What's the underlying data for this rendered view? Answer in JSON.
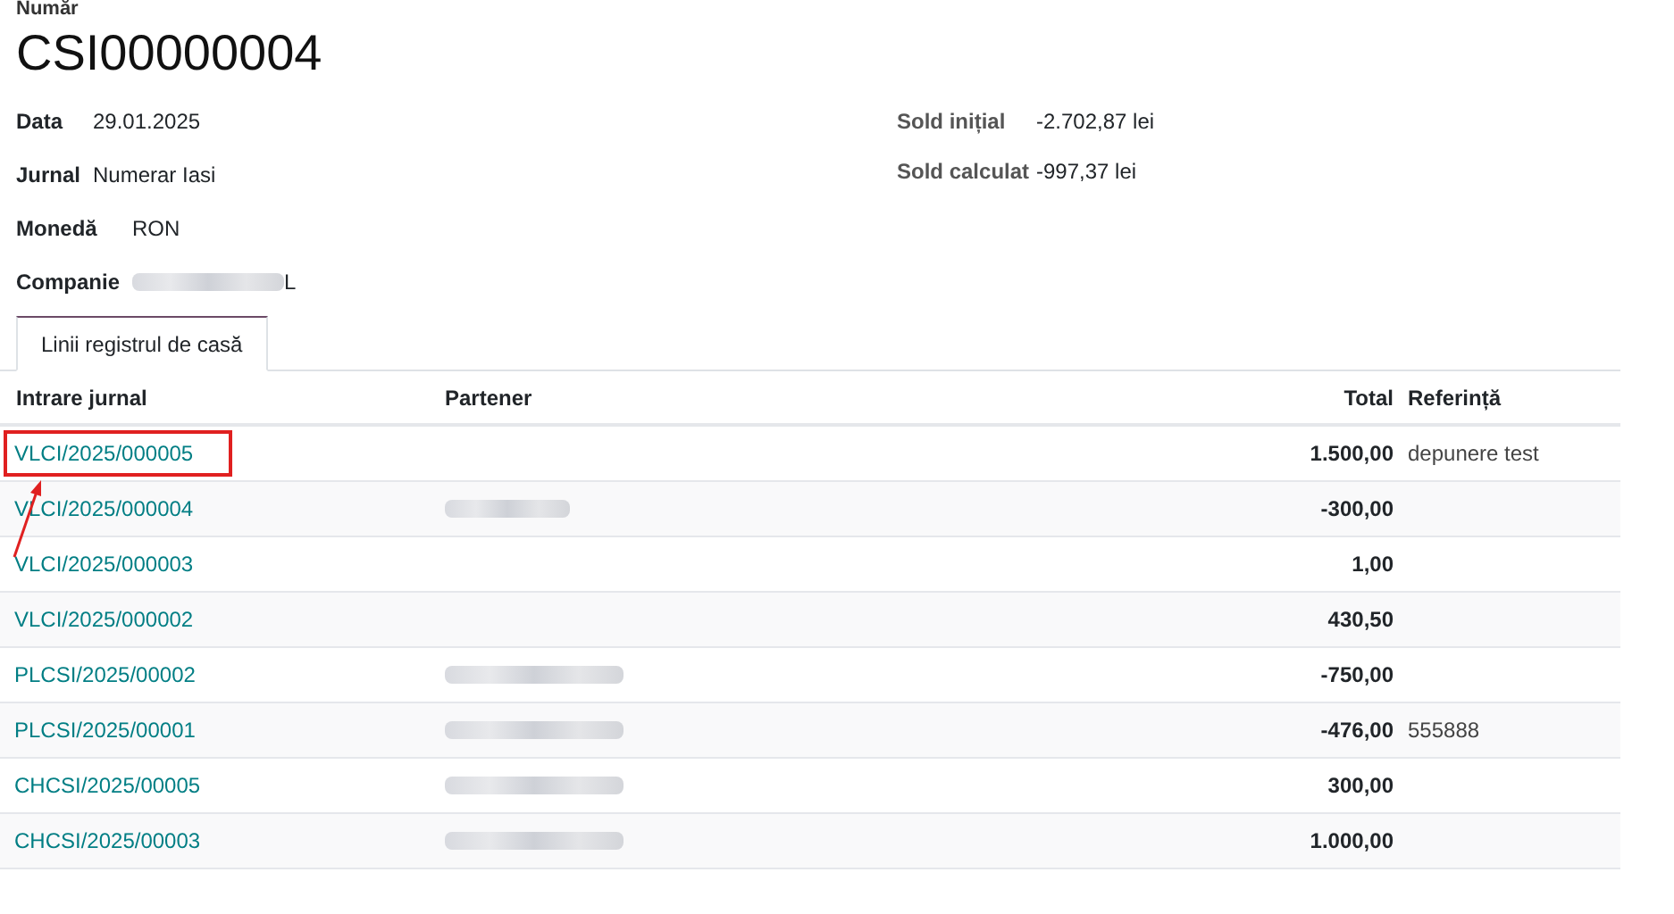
{
  "header": {
    "number_label": "Număr",
    "number": "CSI00000004"
  },
  "fields_left": [
    {
      "label": "Data",
      "value": "29.01.2025",
      "redacted": false
    },
    {
      "label": "Jurnal",
      "value": "Numerar Iasi",
      "redacted": false
    },
    {
      "label": "Monedă",
      "value": "RON",
      "redacted": false
    },
    {
      "label": "Companie",
      "value": "L",
      "redacted": true
    }
  ],
  "fields_right": [
    {
      "label": "Sold inițial",
      "value": "-2.702,87 lei"
    },
    {
      "label": "Sold calculat",
      "value": "-997,37 lei"
    }
  ],
  "tabs": [
    {
      "label": "Linii registrul de casă",
      "selected": true
    }
  ],
  "table": {
    "columns": [
      "Intrare jurnal",
      "Partener",
      "Total",
      "Referință"
    ],
    "rows": [
      {
        "entry": "VLCI/2025/000005",
        "partner_redacted": false,
        "total": "1.500,00",
        "reference": "depunere test",
        "highlighted": true
      },
      {
        "entry": "VLCI/2025/000004",
        "partner_redacted": true,
        "total": "-300,00",
        "highlighted": false
      },
      {
        "entry": "VLCI/2025/000003",
        "partner_redacted": false,
        "total": "1,00",
        "highlighted": false
      },
      {
        "entry": "VLCI/2025/000002",
        "partner_redacted": false,
        "total": "430,50",
        "highlighted": false
      },
      {
        "entry": "PLCSI/2025/00002",
        "partner_redacted": true,
        "total": "-750,00",
        "highlighted": false
      },
      {
        "entry": "PLCSI/2025/00001",
        "partner_redacted": true,
        "total": "-476,00",
        "reference": "555888",
        "highlighted": false
      },
      {
        "entry": "CHCSI/2025/00005",
        "partner_redacted": true,
        "total": "300,00",
        "highlighted": false
      },
      {
        "entry": "CHCSI/2025/00003",
        "partner_redacted": true,
        "total": "1.000,00",
        "highlighted": false
      }
    ]
  }
}
